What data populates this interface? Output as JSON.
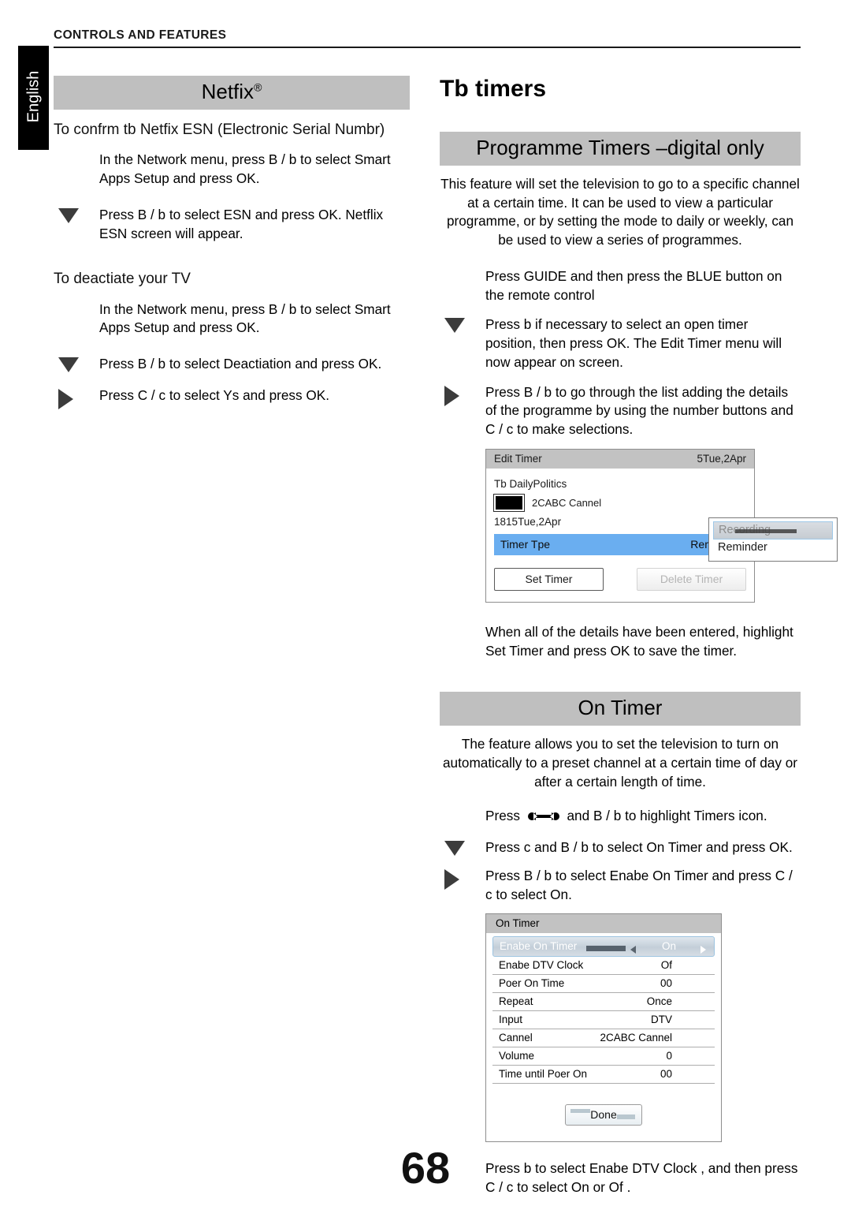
{
  "header": {
    "running_head": "CONTROLS AND FEATURES",
    "language_tab": "English"
  },
  "page_number": "68",
  "left_column": {
    "banner": {
      "title": "Netfix",
      "sup": "®"
    },
    "subhead_1": "To confrm tb Netfix ESN (Electronic Serial Numbr)",
    "steps_1": [
      {
        "bullet": "none",
        "text": "In the Network menu, press B / b  to select Smart Apps Setup and press OK."
      },
      {
        "bullet": "down",
        "text": "Press B / b  to select ESN and press OK. Netflix ESN screen will appear."
      }
    ],
    "subhead_2": "To deactiate your TV",
    "steps_2": [
      {
        "bullet": "none",
        "text": "In the Network menu, press B / b  to select Smart Apps Setup and press OK."
      },
      {
        "bullet": "down",
        "text": "Press B / b  to select Deactiation  and press OK."
      },
      {
        "bullet": "right",
        "text": "Press C / c  to select Ys  and press OK."
      }
    ]
  },
  "right_column": {
    "title": "Tb timers",
    "banner_programme": "Programme Timers –digital only",
    "intro_paragraph": "This feature will set the television to go to a specific channel at a certain time. It can be used to view a particular programme, or by setting the mode to daily or weekly, can be used to view a series of programmes.",
    "steps_programme": [
      {
        "bullet": "none",
        "text": "Press GUIDE and then press the BLUE button on the remote control"
      },
      {
        "bullet": "down",
        "text": "Press b  if necessary to select an open timer position, then press OK. The Edit Timer menu will now appear on screen."
      },
      {
        "bullet": "right",
        "text": "Press B / b  to go through the list adding the details of the programme by using the number buttons and C / c  to make selections."
      }
    ],
    "edit_timer_screen": {
      "title": "Edit Timer",
      "datetime": "5Tue,2Apr",
      "programme": "Tb DailyPolitics",
      "channel": "2CABC  Cannel",
      "time_line": "1815Tue,2Apr",
      "timer_type_label": "Timer Tpe",
      "timer_type_value": "Reminder",
      "buttons": {
        "set": "Set Timer",
        "delete": "Delete Timer"
      },
      "dropdown_options": [
        "Recording",
        "Reminder"
      ]
    },
    "paragraph_after_edit": "When all of the details have been entered, highlight Set Timer and press OK to save the timer.",
    "banner_on_timer": "On Timer",
    "on_timer_intro": "The feature allows you to set the television to turn on automatically to a preset channel at a certain time of day or after a certain length of time.",
    "steps_on_timer": [
      {
        "bullet": "none",
        "text_before": "Press ",
        "icon": "wrench-icon",
        "text_after": " and B / b  to highlight Timers icon."
      },
      {
        "bullet": "down",
        "text": "Press c  and B / b  to select On Timer and press OK."
      },
      {
        "bullet": "right",
        "text": "Press B / b  to select Enabe On Timer  and press C / c  to select On."
      }
    ],
    "on_timer_screen": {
      "title": "On Timer",
      "rows": [
        {
          "label": "Enabe On Timer",
          "value": "On",
          "highlighted": true
        },
        {
          "label": "Enabe DTV Clock",
          "value": "Of",
          "highlighted": false
        },
        {
          "label": "Poer On Time",
          "value": "00",
          "highlighted": false
        },
        {
          "label": "Repeat",
          "value": "Once",
          "highlighted": false
        },
        {
          "label": "Input",
          "value": "DTV",
          "highlighted": false
        },
        {
          "label": "Cannel",
          "value": "2CABC Cannel",
          "highlighted": false
        },
        {
          "label": "Volume",
          "value": "0",
          "highlighted": false
        },
        {
          "label": "Time until Poer On",
          "value": "00",
          "highlighted": false
        }
      ],
      "done_button": "Done"
    },
    "final_paragraph": "Press b  to select Enabe DTV Clock , and then press C / c  to select On or Of ."
  },
  "colors": {
    "banner_gray": "#bfbfbf",
    "tab_black": "#000000",
    "highlight_blue": "#6aaef0",
    "bullet_gray": "#3c3c3c"
  }
}
